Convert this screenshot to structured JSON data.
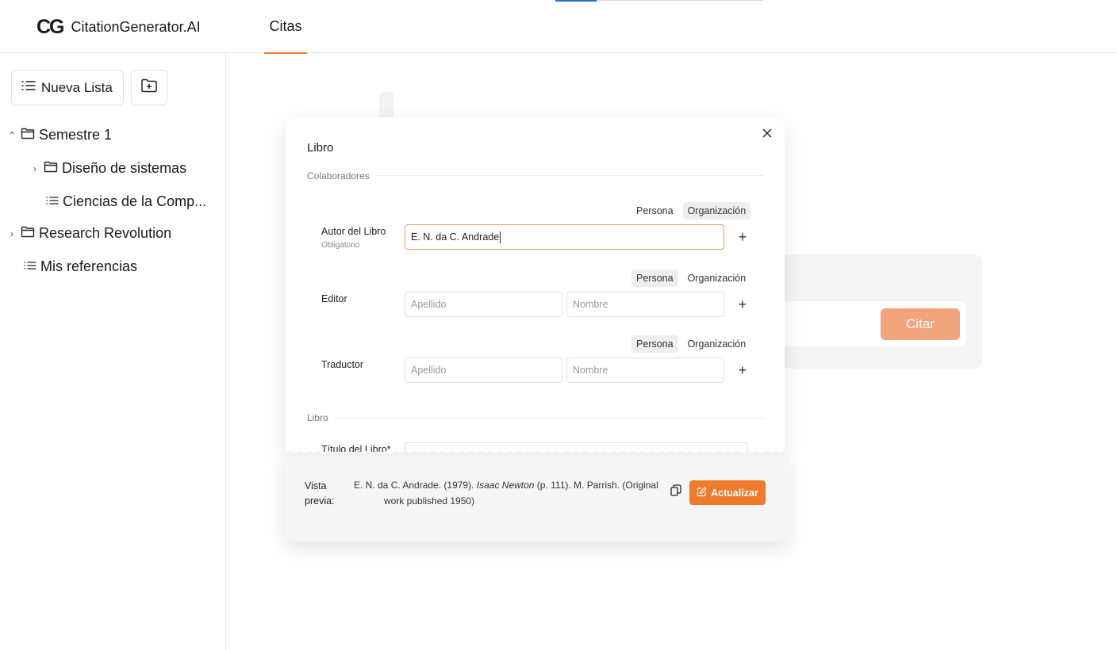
{
  "header": {
    "logo_mark": "CG",
    "logo_text": "CitationGenerator.AI",
    "nav_tab": "Citas",
    "accent_color": "#e87d35"
  },
  "sidebar": {
    "new_list_label": "Nueva Lista",
    "tree": [
      {
        "label": "Semestre 1",
        "icon": "folder-icon",
        "chevron": "up"
      },
      {
        "label": "Diseño de sistemas",
        "icon": "folder-icon",
        "chevron": "right"
      },
      {
        "label": "Ciencias de la Comp...",
        "icon": "list-icon"
      },
      {
        "label": "Research Revolution",
        "icon": "folder-icon",
        "chevron": "right"
      },
      {
        "label": "Mis referencias",
        "icon": "list-icon"
      }
    ]
  },
  "background": {
    "citar_label": "Citar"
  },
  "modal": {
    "title": "Libro",
    "section_contributors": "Colaboradores",
    "section_book": "Libro",
    "toggle_persona": "Persona",
    "toggle_org": "Organización",
    "author": {
      "label": "Autor del Libro",
      "sublabel": "Obligatorio",
      "value": "E. N. da C. Andrade",
      "active_type": "Organización"
    },
    "editor": {
      "label": "Editor",
      "placeholder_last": "Apellido",
      "placeholder_first": "Nombre",
      "active_type": "Persona"
    },
    "translator": {
      "label": "Traductor",
      "placeholder_last": "Apellido",
      "placeholder_first": "Nombre",
      "active_type": "Persona"
    },
    "book_title_label": "Título del Libro*"
  },
  "preview": {
    "label": "Vista previa:",
    "text_before": "E. N. da C. Andrade. (1979). ",
    "text_italic": "Isaac Newton",
    "text_after": " (p. 111). M. Parrish. (Original",
    "text_line2": "work published 1950)",
    "update_label": "Actualizar"
  }
}
